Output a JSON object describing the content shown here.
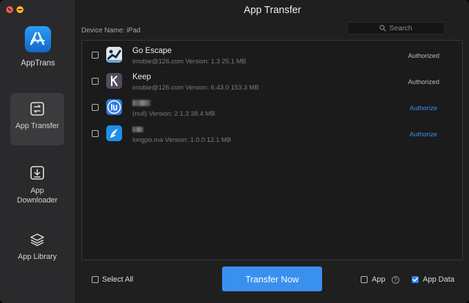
{
  "window": {
    "title": "App Transfer"
  },
  "sidebar": {
    "brand": {
      "name": "AppTrans",
      "icon": "app-store-icon"
    },
    "items": [
      {
        "label": "App Transfer",
        "icon": "transfer-icon",
        "active": true
      },
      {
        "label": "App\nDownloader",
        "icon": "download-icon",
        "active": false
      },
      {
        "label": "App Library",
        "icon": "layers-icon",
        "active": false
      }
    ]
  },
  "header": {
    "device_label": "Device Name: iPad",
    "search_placeholder": "Search"
  },
  "apps": [
    {
      "name": "Go Escape",
      "meta": "imobie@126.com  Version: 1.3  25.1 MB",
      "status": "Authorized",
      "status_type": "authorized",
      "icon": "go-escape-icon"
    },
    {
      "name": "Keep",
      "meta": "imobie@126.com  Version: 6.43.0  153.3 MB",
      "status": "Authorized",
      "status_type": "authorized",
      "icon": "keep-icon"
    },
    {
      "name": "",
      "meta": "(null)  Version: 2.1.3  38.4 MB",
      "status": "Authorize",
      "status_type": "link",
      "icon": "iu-app-icon"
    },
    {
      "name": "",
      "meta": "longpo.ma  Version: 1.0.0  12.1 MB",
      "status": "Authorize",
      "status_type": "link",
      "icon": "feather-app-icon"
    }
  ],
  "footer": {
    "select_all": "Select All",
    "transfer_button": "Transfer Now",
    "app_option": "App",
    "app_checked": false,
    "app_data_option": "App Data",
    "app_data_checked": true,
    "help": "?"
  },
  "colors": {
    "accent": "#3a90ee",
    "link": "#3d8ef5",
    "background": "#1f1f1f",
    "sidebar": "#2a2a2c"
  }
}
